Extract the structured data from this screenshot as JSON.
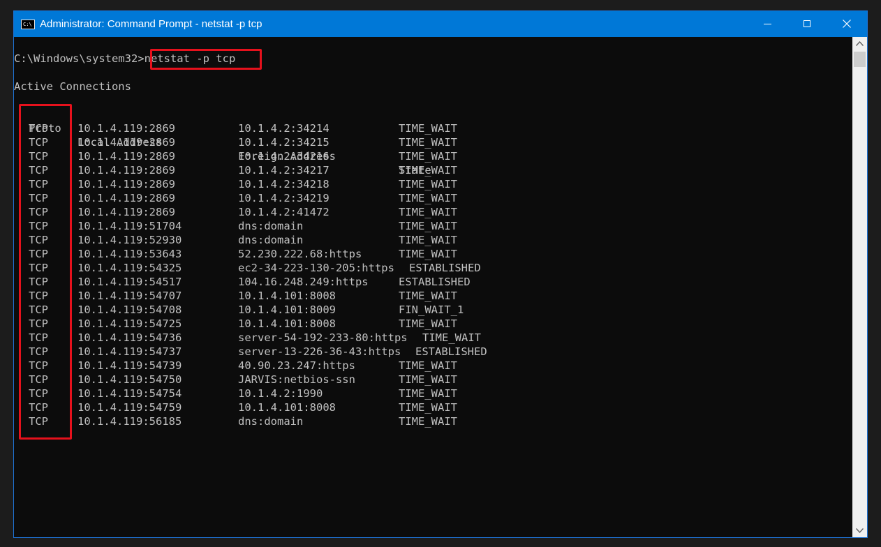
{
  "window": {
    "title": "Administrator: Command Prompt - netstat  -p tcp",
    "icon_label": "C:\\",
    "buttons": {
      "minimize": "minimize",
      "maximize": "maximize",
      "close": "close"
    }
  },
  "console": {
    "prompt": "C:\\Windows\\system32>",
    "command": "netstat -p tcp",
    "heading": "Active Connections",
    "headers": {
      "proto": "Proto",
      "local": "Local Address",
      "foreign": "Foreign Address",
      "state": "State"
    },
    "rows": [
      {
        "proto": "TCP",
        "local": "10.1.4.119:2869",
        "foreign": "10.1.4.2:34214",
        "state": "TIME_WAIT"
      },
      {
        "proto": "TCP",
        "local": "10.1.4.119:2869",
        "foreign": "10.1.4.2:34215",
        "state": "TIME_WAIT"
      },
      {
        "proto": "TCP",
        "local": "10.1.4.119:2869",
        "foreign": "10.1.4.2:34216",
        "state": "TIME_WAIT"
      },
      {
        "proto": "TCP",
        "local": "10.1.4.119:2869",
        "foreign": "10.1.4.2:34217",
        "state": "TIME_WAIT"
      },
      {
        "proto": "TCP",
        "local": "10.1.4.119:2869",
        "foreign": "10.1.4.2:34218",
        "state": "TIME_WAIT"
      },
      {
        "proto": "TCP",
        "local": "10.1.4.119:2869",
        "foreign": "10.1.4.2:34219",
        "state": "TIME_WAIT"
      },
      {
        "proto": "TCP",
        "local": "10.1.4.119:2869",
        "foreign": "10.1.4.2:41472",
        "state": "TIME_WAIT"
      },
      {
        "proto": "TCP",
        "local": "10.1.4.119:51704",
        "foreign": "dns:domain",
        "state": "TIME_WAIT"
      },
      {
        "proto": "TCP",
        "local": "10.1.4.119:52930",
        "foreign": "dns:domain",
        "state": "TIME_WAIT"
      },
      {
        "proto": "TCP",
        "local": "10.1.4.119:53643",
        "foreign": "52.230.222.68:https",
        "state": "TIME_WAIT"
      },
      {
        "proto": "TCP",
        "local": "10.1.4.119:54325",
        "foreign": "ec2-34-223-130-205:https",
        "state": "ESTABLISHED"
      },
      {
        "proto": "TCP",
        "local": "10.1.4.119:54517",
        "foreign": "104.16.248.249:https",
        "state": "ESTABLISHED"
      },
      {
        "proto": "TCP",
        "local": "10.1.4.119:54707",
        "foreign": "10.1.4.101:8008",
        "state": "TIME_WAIT"
      },
      {
        "proto": "TCP",
        "local": "10.1.4.119:54708",
        "foreign": "10.1.4.101:8009",
        "state": "FIN_WAIT_1"
      },
      {
        "proto": "TCP",
        "local": "10.1.4.119:54725",
        "foreign": "10.1.4.101:8008",
        "state": "TIME_WAIT"
      },
      {
        "proto": "TCP",
        "local": "10.1.4.119:54736",
        "foreign": "server-54-192-233-80:https",
        "state": "TIME_WAIT"
      },
      {
        "proto": "TCP",
        "local": "10.1.4.119:54737",
        "foreign": "server-13-226-36-43:https",
        "state": "ESTABLISHED"
      },
      {
        "proto": "TCP",
        "local": "10.1.4.119:54739",
        "foreign": "40.90.23.247:https",
        "state": "TIME_WAIT"
      },
      {
        "proto": "TCP",
        "local": "10.1.4.119:54750",
        "foreign": "JARVIS:netbios-ssn",
        "state": "TIME_WAIT"
      },
      {
        "proto": "TCP",
        "local": "10.1.4.119:54754",
        "foreign": "10.1.4.2:1990",
        "state": "TIME_WAIT"
      },
      {
        "proto": "TCP",
        "local": "10.1.4.119:54759",
        "foreign": "10.1.4.101:8008",
        "state": "TIME_WAIT"
      },
      {
        "proto": "TCP",
        "local": "10.1.4.119:56185",
        "foreign": "dns:domain",
        "state": "TIME_WAIT"
      }
    ]
  },
  "colors": {
    "titlebar": "#0078d7",
    "console_bg": "#0c0c0c",
    "console_text": "#c0c0c0",
    "highlight": "#e6111c"
  }
}
